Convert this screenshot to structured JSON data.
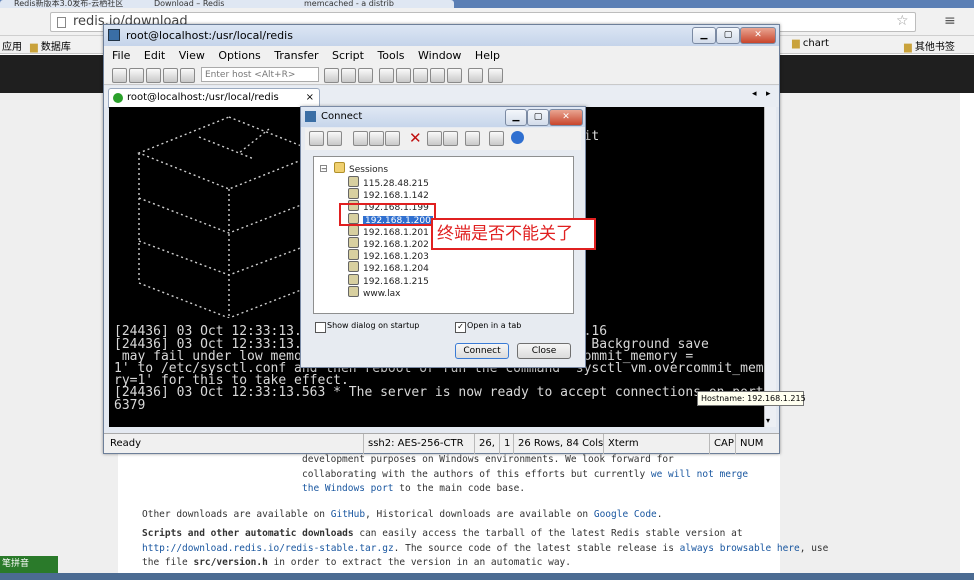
{
  "browser": {
    "tabs": [
      "Redis新版本3.0发布-云栖社区",
      "Download – Redis",
      "memcached - a distrib"
    ],
    "address": "redis.io/download",
    "bookmarks_left": [
      "应用",
      "数据库"
    ],
    "bookmarks_right": [
      "chart",
      "其他书签"
    ]
  },
  "page": {
    "lines": [
      {
        "parts": [
          {
            "t": "development purposes on Windows environments. We look forward for"
          }
        ]
      },
      {
        "parts": [
          {
            "t": "collaborating with the authors of this efforts but currently "
          },
          {
            "t": "we will not merge",
            "link": true
          }
        ]
      },
      {
        "parts": [
          {
            "t": "the Windows port",
            "link": true
          },
          {
            "t": " to the main code base."
          }
        ]
      }
    ],
    "other_downloads": [
      {
        "t": "Other downloads are available on "
      },
      {
        "t": "GitHub",
        "link": true
      },
      {
        "t": ", Historical downloads are available on "
      },
      {
        "t": "Google Code",
        "link": true
      },
      {
        "t": "."
      }
    ],
    "scripts_lines": [
      {
        "parts": [
          {
            "t": "Scripts and other automatic downloads",
            "bold": true
          },
          {
            "t": " can easily access the tarball of the latest Redis stable version at"
          }
        ]
      },
      {
        "parts": [
          {
            "t": "http://download.redis.io/redis-stable.tar.gz",
            "link": true
          },
          {
            "t": ". The source code of the latest stable release is "
          },
          {
            "t": "always browsable here",
            "link": true
          },
          {
            "t": ", use"
          }
        ]
      },
      {
        "parts": [
          {
            "t": "the file "
          },
          {
            "t": "src/version.h",
            "bold": true
          },
          {
            "t": " in order to extract the version in an automatic way."
          }
        ]
      }
    ]
  },
  "crt": {
    "title": "root@localhost:/usr/local/redis",
    "menu": [
      "File",
      "Edit",
      "View",
      "Options",
      "Transfer",
      "Script",
      "Tools",
      "Window",
      "Help"
    ],
    "host_placeholder": "Enter host <Alt+R>",
    "tab_label": "root@localhost:/usr/local/redis",
    "terminal_lines": [
      "                                                                ",
      "                                                   0/0) 64 bit  ",
      "                                                                ",
      "                                                   e mode       ",
      "                                                                ",
      "                                                                ",
      "                                                                ",
      "                                                                ",
      "                                                                ",
      "                                                                ",
      "                                                                ",
      "                                                                ",
      "                                                                ",
      "                                                                ",
      "                                                                ",
      "                                                                ",
      "                                                                ",
      "[24436] 03 Oct 12:33:13.                                   6.16",
      "[24436] 03 Oct 12:33:13.                             t to 0! Background save",
      " may fail under low memo                            vm.overcommit_memory =",
      "1' to /etc/sysctl.conf and then reboot or run the command 'sysctl vm.overcommit_memo",
      "ry=1' for this to take effect.",
      "[24436] 03 Oct 12:33:13.563 * The server is now ready to accept connections on port",
      "6379"
    ],
    "status": {
      "ready": "Ready",
      "cipher": "ssh2: AES-256-CTR",
      "row": "26,",
      "col": "1",
      "size": "26 Rows, 84 Cols",
      "term": "Xterm",
      "caps": "CAP",
      "num": "NUM"
    }
  },
  "dialog": {
    "title": "Connect",
    "root": "Sessions",
    "sessions": [
      "115.28.48.215",
      "192.168.1.142",
      "192.168.1.199",
      "192.168.1.200",
      "192.168.1.201",
      "192.168.1.202",
      "192.168.1.203",
      "192.168.1.204",
      "192.168.1.215",
      "www.lax"
    ],
    "selected_index": 3,
    "tooltip": "Hostname: 192.168.1.215",
    "show_on_startup": "Show dialog on startup",
    "open_in_tab": "Open in a tab",
    "connect": "Connect",
    "close": "Close"
  },
  "annotation": "终端是否不能关了",
  "ime": "笔拼音"
}
